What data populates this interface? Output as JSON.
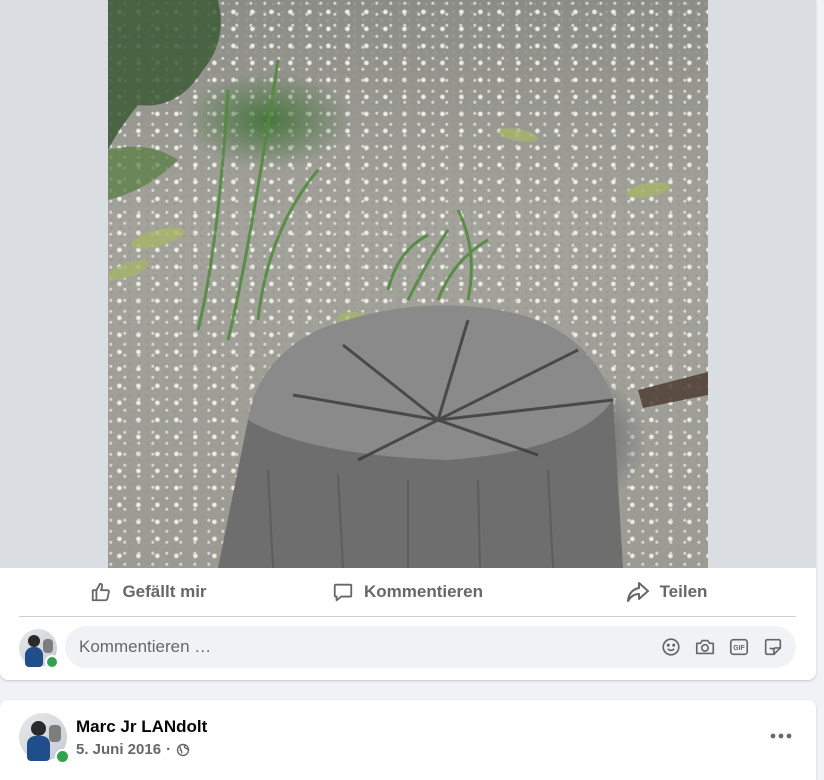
{
  "post1": {
    "actions": {
      "like_label": "Gefällt mir",
      "comment_label": "Kommentieren",
      "share_label": "Teilen"
    },
    "comment_box": {
      "placeholder": "Kommentieren …",
      "icons": [
        "emoji-icon",
        "camera-icon",
        "gif-icon",
        "sticker-icon"
      ]
    }
  },
  "post2": {
    "author_name": "Marc Jr LANdolt",
    "date": "5. Juni 2016",
    "separator": "·",
    "audience_icon": "globe-icon"
  },
  "colors": {
    "page_bg": "#f0f2f5",
    "card_bg": "#ffffff",
    "secondary_text": "#65676b",
    "online_green": "#31a24c"
  }
}
